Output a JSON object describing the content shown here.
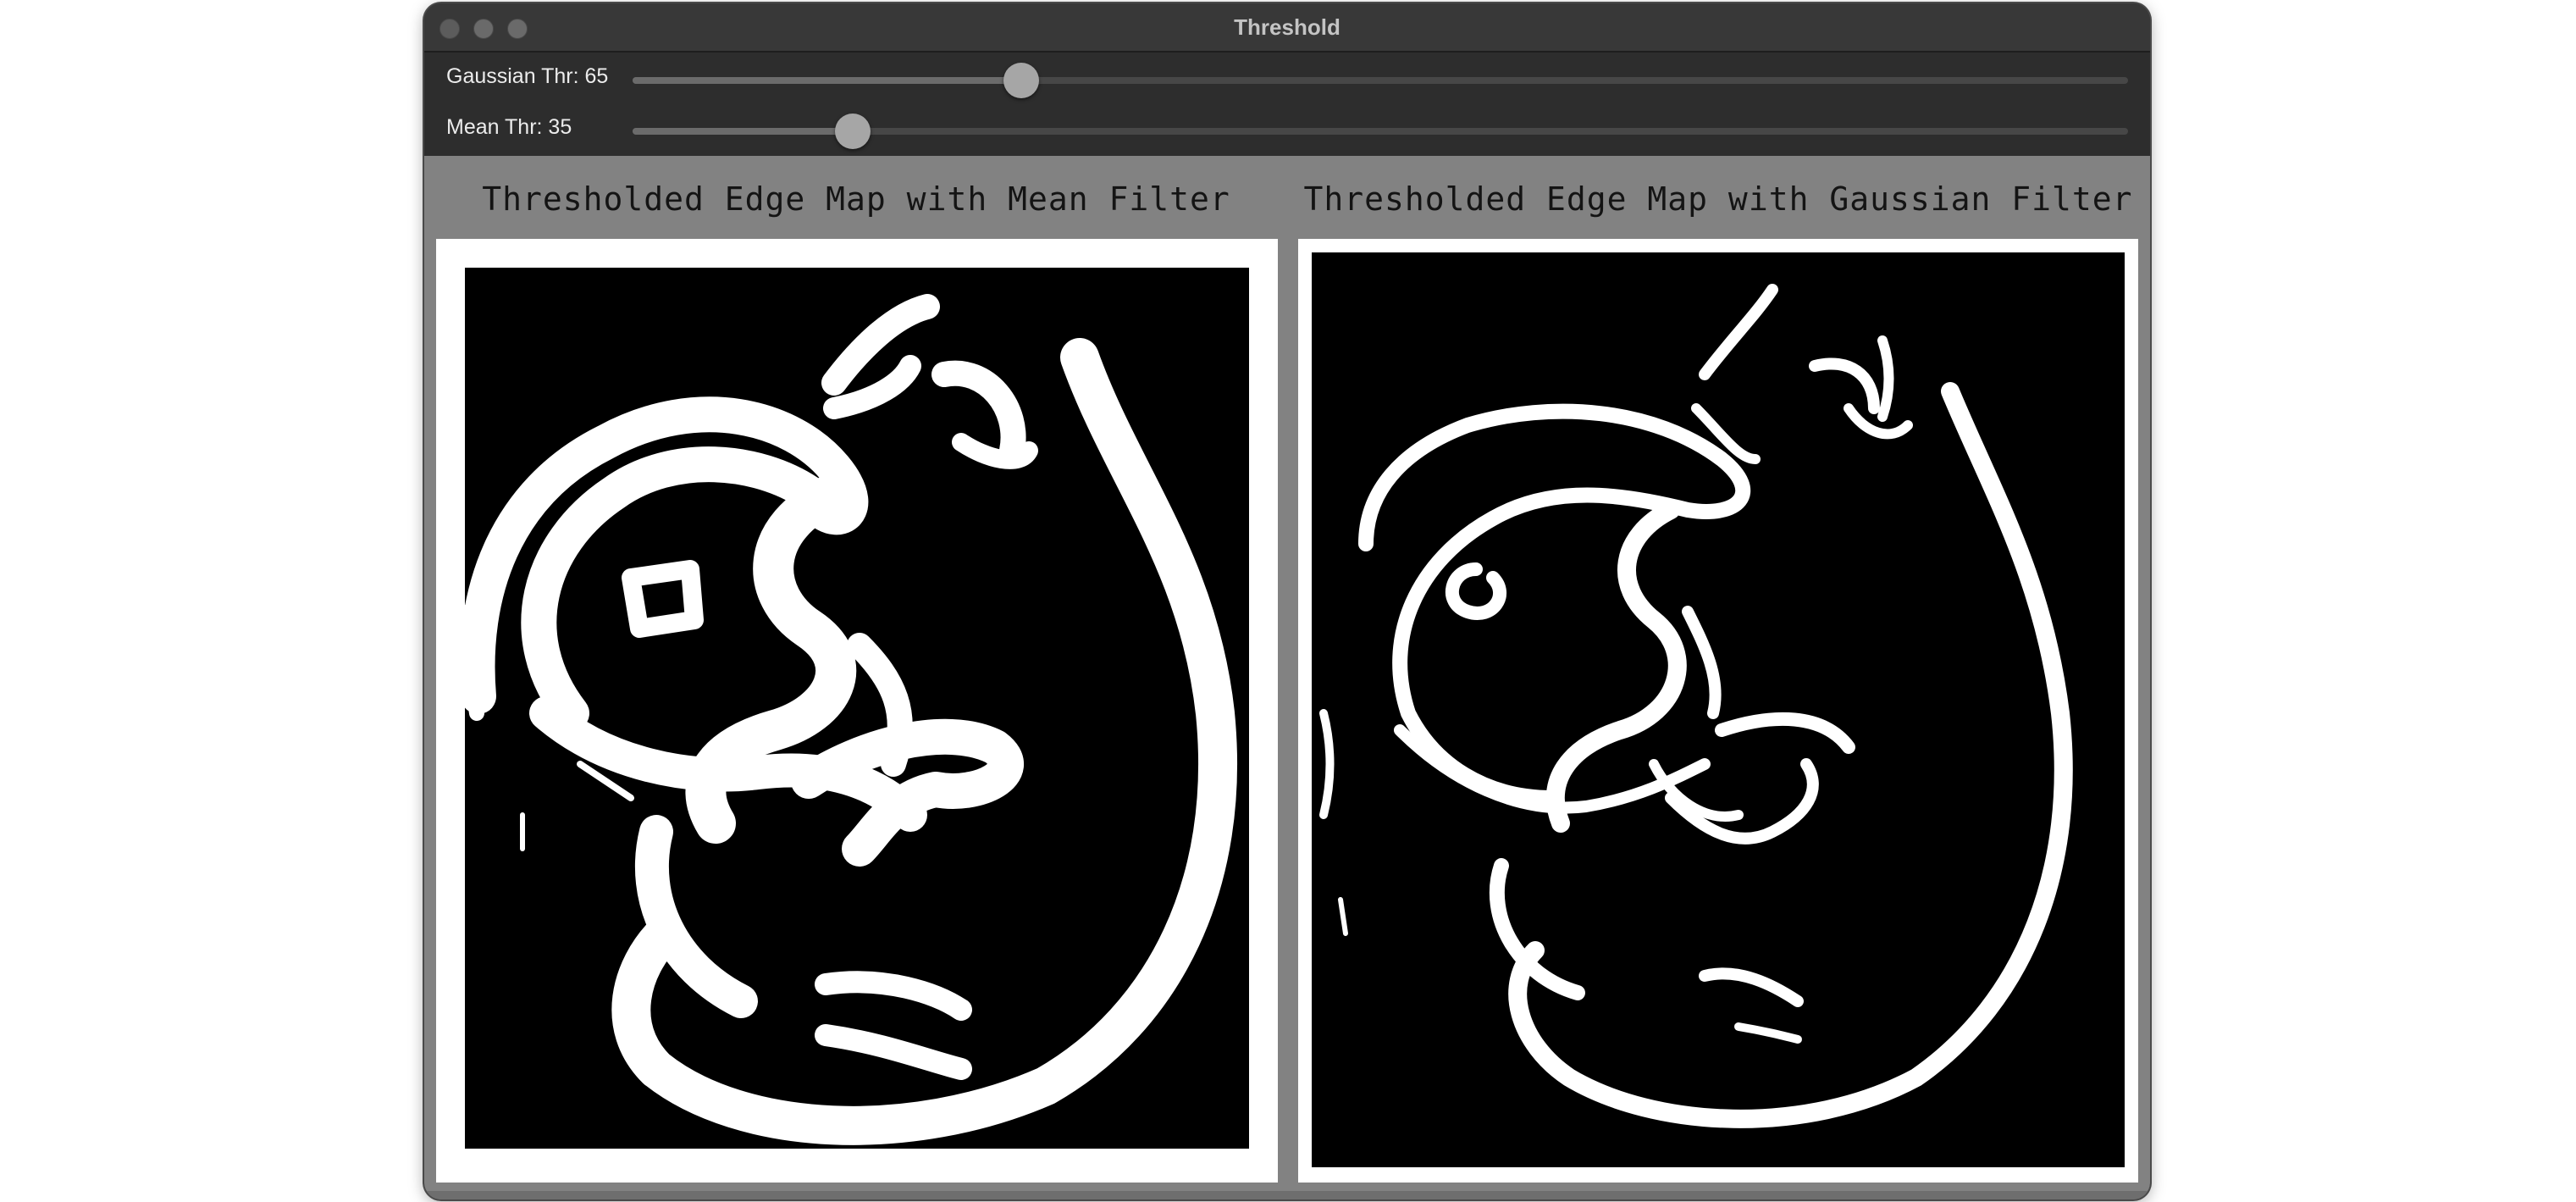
{
  "window": {
    "title": "Threshold"
  },
  "controls": {
    "gaussian_label": "Gaussian Thr: 65",
    "gaussian_fraction": 0.26,
    "mean_label": "Mean Thr: 35",
    "mean_fraction": 0.147
  },
  "panels": {
    "left_title": "Thresholded Edge Map with Mean Filter",
    "right_title": "Thresholded Edge Map with Gaussian Filter"
  },
  "colors": {
    "edge": "#ffffff",
    "background": "#000000",
    "canvas": "#828282"
  },
  "icons": {
    "close": "traffic-light-close-icon",
    "minimize": "traffic-light-minimize-icon",
    "maximize": "traffic-light-maximize-icon"
  }
}
